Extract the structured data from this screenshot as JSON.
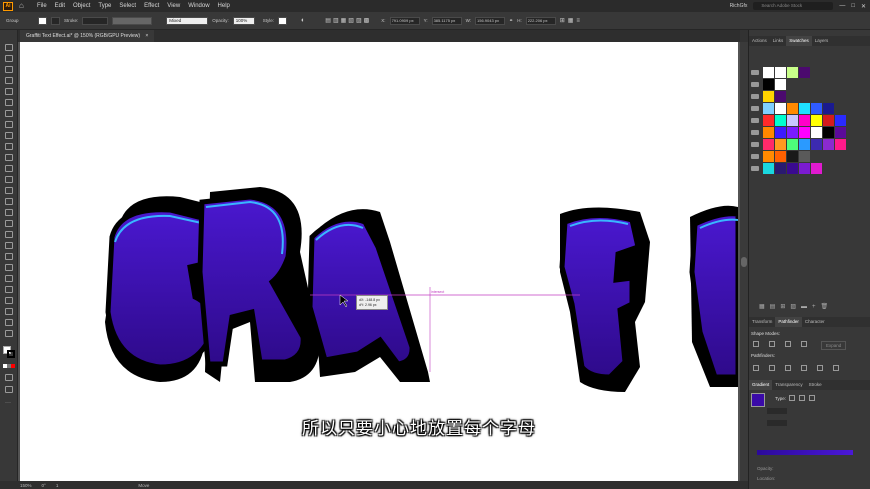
{
  "menubar": {
    "logo": "Ai",
    "items": [
      "File",
      "Edit",
      "Object",
      "Type",
      "Select",
      "Effect",
      "View",
      "Window",
      "Help"
    ],
    "user": "RichGfx",
    "search_placeholder": "Search Adobe Stock"
  },
  "control_bar": {
    "selection": "Group",
    "stroke_label": "Stroke:",
    "blend_mode": "Mixed",
    "opacity_label": "Opacity:",
    "opacity_value": "100%",
    "style_label": "Style:",
    "x_label": "X:",
    "x_value": "791.0909 px",
    "y_label": "Y:",
    "y_value": "385.1175 px",
    "w_label": "W:",
    "w_value": "156.9043 px",
    "h_label": "H:",
    "h_value": "222.206 px"
  },
  "document_tab": {
    "title": "Graffiti Text Effect.ai* @ 150% (RGB/GPU Preview)",
    "close": "×"
  },
  "canvas": {
    "subtitle": "所以只要小心地放置每个字母",
    "tooltip_dx": "dX: -148.8 px",
    "tooltip_dy": "dY: 2.96 px",
    "measure_label": "intersect",
    "artwork": {
      "letters": [
        "G",
        "R",
        "A",
        "F",
        "F"
      ],
      "fill_color": "#3a10b8",
      "outline_color": "#000000",
      "highlight_color": "#39b6ff"
    }
  },
  "statusbar": {
    "zoom": "150%",
    "rotation": "0°",
    "artboard_index": "1",
    "tool_label": "Move"
  },
  "panels": {
    "top_tabs": [
      "Actions",
      "Links",
      "Swatches",
      "Layers"
    ],
    "top_active": "Swatches",
    "swatch_rows": [
      [
        "#ffffff",
        "#ffffff",
        "#c9ff8a",
        "#4b0a6e"
      ],
      [
        "#000000",
        "#ffffff"
      ],
      [
        "#ffd400",
        "#4b0a6e"
      ],
      [
        "#7fd0ff",
        "#ffffff",
        "#ff8a00",
        "#1fe0ff",
        "#2f5bff",
        "#1a1a90"
      ],
      [
        "#ff2a2a",
        "#00ffd0",
        "#c8c8ff",
        "#ff00c8",
        "#ffff00",
        "#d41c1c",
        "#2a2aff"
      ],
      [
        "#ff8800",
        "#3c1bff",
        "#7b1bff",
        "#ff00ff",
        "#ffffff",
        "#000000",
        "#5b0a9a"
      ],
      [
        "#ff2a6a",
        "#ff9a20",
        "#4dff7a",
        "#2a9aff",
        "#3c2ab0",
        "#8a2ad0",
        "#ff1a8a"
      ],
      [
        "#ff8a00",
        "#ff6000",
        "#1a1a1a",
        "#5a5a5a"
      ],
      [
        "#1ad8e0",
        "#2a1a70",
        "#3a0a90",
        "#7b1bd0",
        "#e01ad0"
      ]
    ],
    "mid_tabs": [
      "Transform",
      "Pathfinder",
      "Character"
    ],
    "mid_active": "Pathfinder",
    "shape_modes_label": "Shape Modes:",
    "expand_label": "Expand",
    "pathfinders_label": "Pathfinders:",
    "bottom_tabs": [
      "Gradient",
      "Transparency",
      "Stroke"
    ],
    "bottom_active": "Gradient",
    "type_label": "Type:",
    "opacity_label": "Opacity:",
    "location_label": "Location:",
    "gradient_colors": [
      "#2b0a9a",
      "#4b18d8"
    ]
  }
}
